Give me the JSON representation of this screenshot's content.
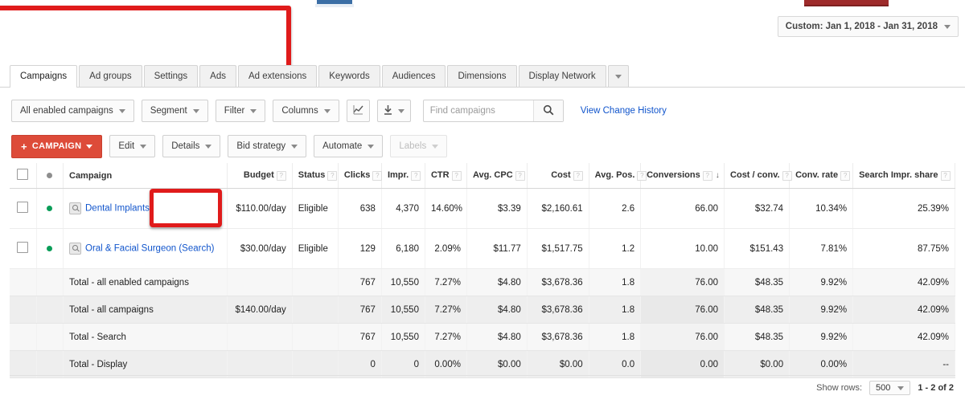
{
  "topbar": {
    "date_range": "Custom: Jan 1, 2018 - Jan 31, 2018"
  },
  "tabs": [
    {
      "label": "Campaigns",
      "active": true
    },
    {
      "label": "Ad groups",
      "active": false
    },
    {
      "label": "Settings",
      "active": false
    },
    {
      "label": "Ads",
      "active": false
    },
    {
      "label": "Ad extensions",
      "active": false
    },
    {
      "label": "Keywords",
      "active": false
    },
    {
      "label": "Audiences",
      "active": false
    },
    {
      "label": "Dimensions",
      "active": false
    },
    {
      "label": "Display Network",
      "active": false
    }
  ],
  "filter_toolbar": {
    "campaign_filter": "All enabled campaigns",
    "segment": "Segment",
    "filter": "Filter",
    "columns": "Columns",
    "chart_icon": "chart-icon",
    "download_icon": "download-icon",
    "search_placeholder": "Find campaigns",
    "search_value": "",
    "search_icon": "search-icon",
    "view_change_history": "View Change History"
  },
  "action_toolbar": {
    "campaign_button": "CAMPAIGN",
    "edit": "Edit",
    "details": "Details",
    "bid_strategy": "Bid strategy",
    "automate": "Automate",
    "labels": "Labels"
  },
  "table": {
    "columns": [
      {
        "label": "Campaign",
        "help": true,
        "align": "lft",
        "sorted": false
      },
      {
        "label": "Budget",
        "help": true,
        "align": "num",
        "sorted": false
      },
      {
        "label": "Status",
        "help": true,
        "align": "lft",
        "sorted": false
      },
      {
        "label": "Clicks",
        "help": true,
        "align": "num",
        "sorted": false
      },
      {
        "label": "Impr.",
        "help": true,
        "align": "num",
        "sorted": false
      },
      {
        "label": "CTR",
        "help": true,
        "align": "num",
        "sorted": false
      },
      {
        "label": "Avg. CPC",
        "help": true,
        "align": "num",
        "sorted": false
      },
      {
        "label": "Cost",
        "help": true,
        "align": "num",
        "sorted": false
      },
      {
        "label": "Avg. Pos.",
        "help": true,
        "align": "num",
        "sorted": false
      },
      {
        "label": "Conversions",
        "help": true,
        "align": "num",
        "sorted": true,
        "sort_dir": "↓"
      },
      {
        "label": "Cost / conv.",
        "help": true,
        "align": "num",
        "sorted": false
      },
      {
        "label": "Conv. rate",
        "help": true,
        "align": "num",
        "sorted": false
      },
      {
        "label": "Search Impr. share",
        "help": true,
        "align": "num",
        "sorted": false
      }
    ],
    "rows": [
      {
        "campaign": "Dental Implants",
        "budget": "$110.00/day",
        "status": "Eligible",
        "clicks": "638",
        "impr": "4,370",
        "ctr": "14.60%",
        "avg_cpc": "$3.39",
        "cost": "$2,160.61",
        "avg_pos": "2.6",
        "conversions": "66.00",
        "cost_conv": "$32.74",
        "conv_rate": "10.34%",
        "search_impr_share": "25.39%"
      },
      {
        "campaign": "Oral & Facial Surgeon (Search)",
        "budget": "$30.00/day",
        "status": "Eligible",
        "clicks": "129",
        "impr": "6,180",
        "ctr": "2.09%",
        "avg_cpc": "$11.77",
        "cost": "$1,517.75",
        "avg_pos": "1.2",
        "conversions": "10.00",
        "cost_conv": "$151.43",
        "conv_rate": "7.81%",
        "search_impr_share": "87.75%"
      }
    ],
    "totals": [
      {
        "label": "Total - all enabled campaigns",
        "budget": "",
        "status": "",
        "clicks": "767",
        "impr": "10,550",
        "ctr": "7.27%",
        "avg_cpc": "$4.80",
        "cost": "$3,678.36",
        "avg_pos": "1.8",
        "conversions": "76.00",
        "cost_conv": "$48.35",
        "conv_rate": "9.92%",
        "search_impr_share": "42.09%"
      },
      {
        "label": "Total - all campaigns",
        "budget": "$140.00/day",
        "status": "",
        "clicks": "767",
        "impr": "10,550",
        "ctr": "7.27%",
        "avg_cpc": "$4.80",
        "cost": "$3,678.36",
        "avg_pos": "1.8",
        "conversions": "76.00",
        "cost_conv": "$48.35",
        "conv_rate": "9.92%",
        "search_impr_share": "42.09%"
      },
      {
        "label": "Total - Search",
        "budget": "",
        "status": "",
        "clicks": "767",
        "impr": "10,550",
        "ctr": "7.27%",
        "avg_cpc": "$4.80",
        "cost": "$3,678.36",
        "avg_pos": "1.8",
        "conversions": "76.00",
        "cost_conv": "$48.35",
        "conv_rate": "9.92%",
        "search_impr_share": "42.09%"
      },
      {
        "label": "Total - Display",
        "budget": "",
        "status": "",
        "clicks": "0",
        "impr": "0",
        "ctr": "0.00%",
        "avg_cpc": "$0.00",
        "cost": "$0.00",
        "avg_pos": "0.0",
        "conversions": "0.00",
        "cost_conv": "$0.00",
        "conv_rate": "0.00%",
        "search_impr_share": "--"
      }
    ]
  },
  "footer": {
    "show_rows_label": "Show rows:",
    "rows_value": "500",
    "page_info": "1 - 2 of 2"
  },
  "colors": {
    "accent_red": "#dd4b39",
    "redaction_red": "#e01b1b",
    "link_blue": "#1155cc",
    "status_green": "#0a9d58"
  }
}
